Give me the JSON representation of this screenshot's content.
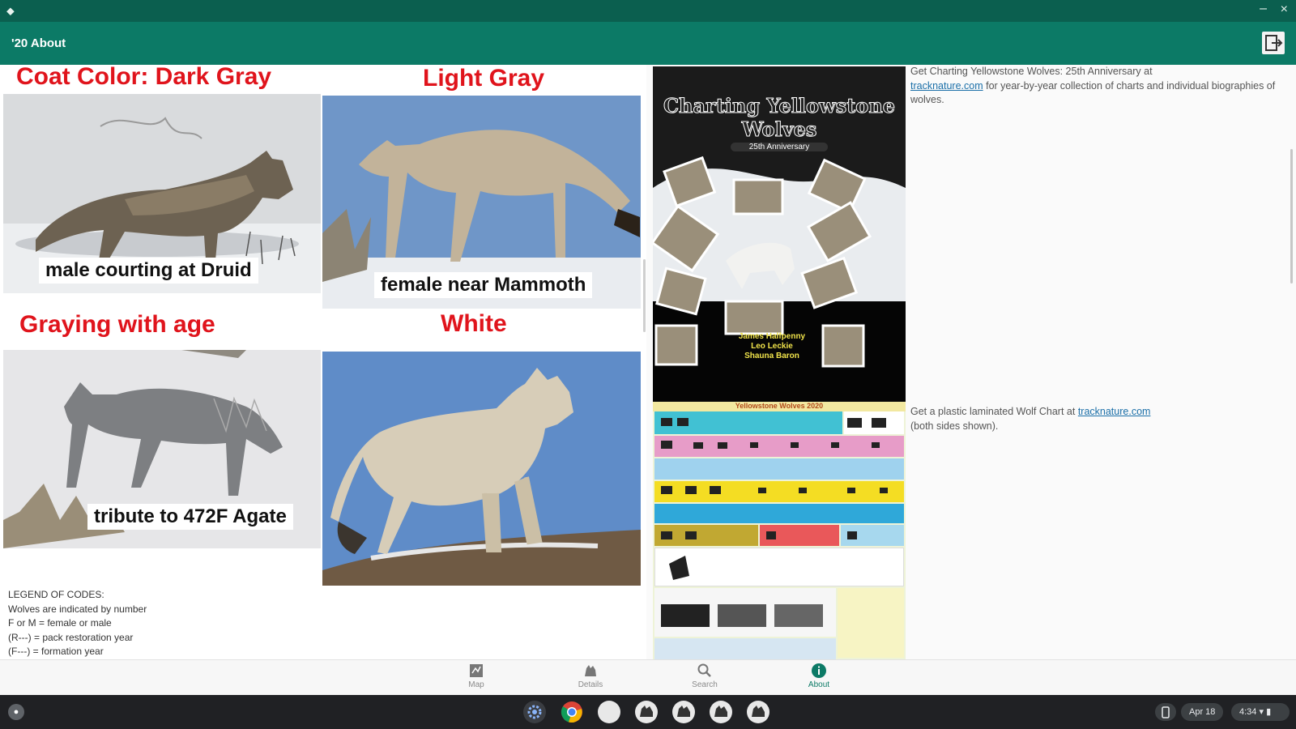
{
  "window": {
    "title_left": "⬥",
    "min": "–",
    "close": "×"
  },
  "appbar": {
    "title": "'20 About",
    "action_icon": "exit-icon"
  },
  "panels": [
    {
      "heading": "Coat Color:  Dark Gray",
      "caption": "male courting at Druid"
    },
    {
      "heading": "Light Gray",
      "caption": "female near Mammoth"
    },
    {
      "heading": "Graying with age",
      "caption": "tribute to 472F Agate"
    },
    {
      "heading": "White",
      "caption": ""
    }
  ],
  "legend": {
    "lines": [
      "LEGEND OF CODES:",
      "Wolves are indicated by number",
      "F or M = female or male",
      "(R---) = pack restoration year",
      "(F---) = formation year"
    ]
  },
  "book": {
    "title": "Charting Yellowstone Wolves",
    "subtitle": "25th Anniversary",
    "authors": [
      "James Halfpenny",
      "Leo Leckie",
      "Shauna Baron"
    ]
  },
  "chart": {
    "title": "Yellowstone Wolves 2020"
  },
  "side": {
    "book_text_1": "Get Charting Yellowstone Wolves: 25th Anniversary at",
    "book_link": "tracknature.com",
    "book_text_2": " for year-by-year collection of charts and individual biographies of wolves.",
    "chart_text_1": "Get a plastic laminated Wolf Chart at ",
    "chart_link": "tracknature.com",
    "chart_text_2": "(both sides shown)."
  },
  "nav": [
    {
      "label": "Map",
      "icon": "map-icon"
    },
    {
      "label": "Details",
      "icon": "wolf-icon"
    },
    {
      "label": "Search",
      "icon": "search-icon"
    },
    {
      "label": "About",
      "icon": "info-icon"
    }
  ],
  "shelf": {
    "date": "Apr 18",
    "time": "4:34"
  },
  "colors": {
    "appbar": "#0c7a66",
    "titlebar": "#0b5f4f",
    "heading_red": "#e0141c",
    "link": "#1b6fa8"
  }
}
